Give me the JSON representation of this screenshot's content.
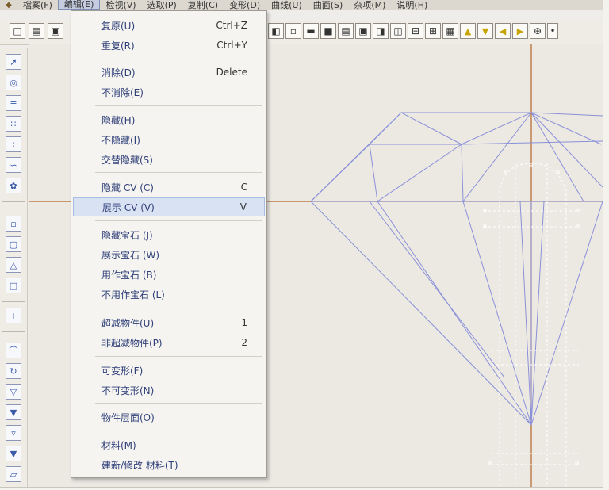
{
  "menubar": {
    "items": [
      {
        "label": "檔案(F)"
      },
      {
        "label": "编辑(E)"
      },
      {
        "label": "检视(V)"
      },
      {
        "label": "选取(P)"
      },
      {
        "label": "复制(C)"
      },
      {
        "label": "变形(D)"
      },
      {
        "label": "曲线(U)"
      },
      {
        "label": "曲面(S)"
      },
      {
        "label": "杂项(M)"
      },
      {
        "label": "说明(H)"
      }
    ]
  },
  "edit_menu": {
    "items": [
      {
        "label": "复原(U)",
        "shortcut": "Ctrl+Z"
      },
      {
        "label": "重复(R)",
        "shortcut": "Ctrl+Y"
      },
      {
        "label": "消除(D)",
        "shortcut": "Delete"
      },
      {
        "label": "不消除(E)",
        "shortcut": ""
      },
      {
        "label": "隐藏(H)",
        "shortcut": ""
      },
      {
        "label": "不隐藏(I)",
        "shortcut": ""
      },
      {
        "label": "交替隐藏(S)",
        "shortcut": ""
      },
      {
        "label": "隐藏 CV (C)",
        "shortcut": "C"
      },
      {
        "label": "展示 CV (V)",
        "shortcut": "V"
      },
      {
        "label": "隐藏宝石 (J)",
        "shortcut": ""
      },
      {
        "label": "展示宝石 (W)",
        "shortcut": ""
      },
      {
        "label": "用作宝石 (B)",
        "shortcut": ""
      },
      {
        "label": "不用作宝石 (L)",
        "shortcut": ""
      },
      {
        "label": "超减物件(U)",
        "shortcut": "1"
      },
      {
        "label": "非超减物件(P)",
        "shortcut": "2"
      },
      {
        "label": "可变形(F)",
        "shortcut": ""
      },
      {
        "label": "不可变形(N)",
        "shortcut": ""
      },
      {
        "label": "物件层面(O)",
        "shortcut": ""
      },
      {
        "label": "材料(M)",
        "shortcut": ""
      },
      {
        "label": "建新/修改 材料(T)",
        "shortcut": ""
      }
    ],
    "highlighted_index": 8
  },
  "colors": {
    "menu_text": "#2f3f78",
    "highlight": "#d9e2f3",
    "wire": "#8a90d8",
    "axis": "#b5652a",
    "cv": "#ffffff"
  }
}
